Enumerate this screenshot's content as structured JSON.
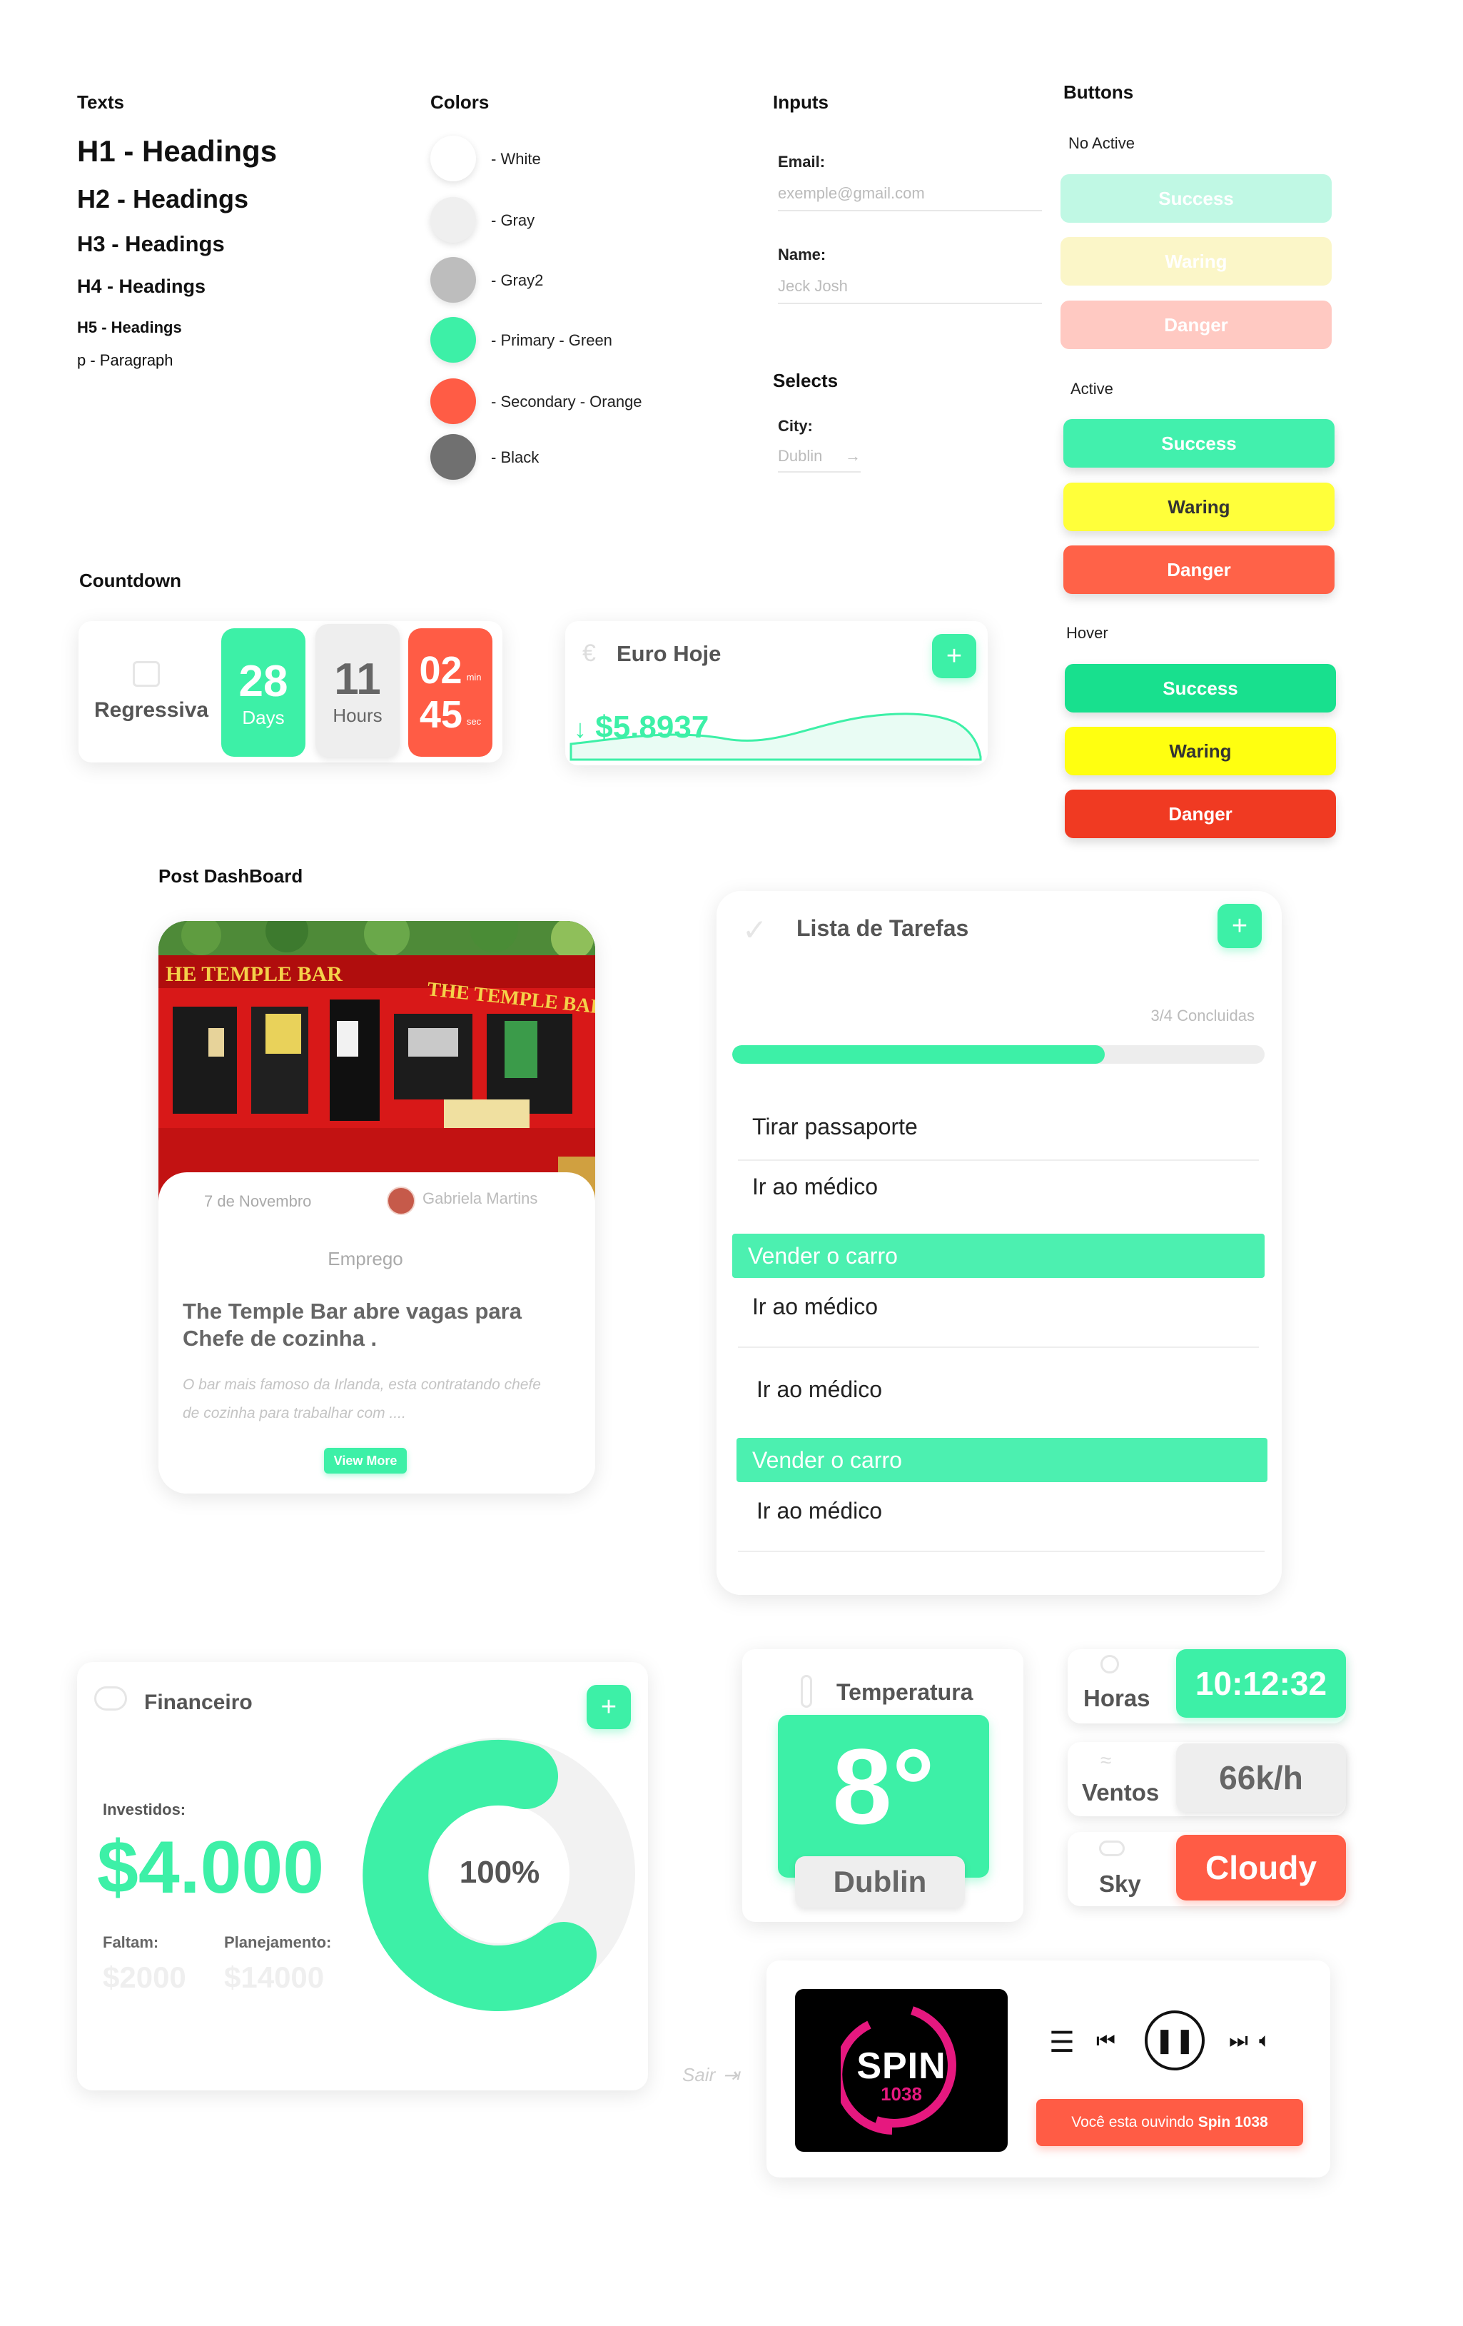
{
  "texts": {
    "title": "Texts",
    "h1": "H1 - Headings",
    "h2": "H2 - Headings",
    "h3": "H3 - Headings",
    "h4": "H4 - Headings",
    "h5": "H5 - Headings",
    "p": "p - Paragraph"
  },
  "colors": {
    "title": "Colors",
    "items": [
      {
        "label": "- White",
        "hex": "#ffffff"
      },
      {
        "label": "- Gray",
        "hex": "#efefef"
      },
      {
        "label": "- Gray2",
        "hex": "#bdbdbd"
      },
      {
        "label": "-  Primary - Green",
        "hex": "#3df0a7"
      },
      {
        "label": "- Secondary - Orange",
        "hex": "#ff5c45"
      },
      {
        "label": "- Black",
        "hex": "#707070"
      }
    ]
  },
  "inputs": {
    "title": "Inputs",
    "email_label": "Email:",
    "email_placeholder": "exemple@gmail.com",
    "name_label": "Name:",
    "name_placeholder": "Jeck Josh"
  },
  "selects": {
    "title": "Selects",
    "city_label": "City:",
    "city_value": "Dublin",
    "arrow_icon": "→"
  },
  "buttons": {
    "title": "Buttons",
    "no_active": {
      "label": "No Active",
      "success": "Success",
      "warning": "Waring",
      "danger": "Danger"
    },
    "active": {
      "label": "Active",
      "success": "Success",
      "warning": "Waring",
      "danger": "Danger"
    },
    "hover": {
      "label": "Hover",
      "success": "Success",
      "warning": "Waring",
      "danger": "Danger"
    },
    "colors": {
      "success": "#3df0a7",
      "warning": "#ffff2a",
      "danger": "#ff5c45"
    }
  },
  "countdown": {
    "title": "Countdown",
    "label": "Regressiva",
    "days_value": "28",
    "days_label": "Days",
    "hours_value": "11",
    "hours_label": "Hours",
    "min_value": "02",
    "min_label": "min",
    "sec_value": "45",
    "sec_label": "sec"
  },
  "euro": {
    "title": "Euro Hoje",
    "value": "$5.8937",
    "plus": "+"
  },
  "post": {
    "section_title": "Post DashBoard",
    "date": "7 de Novembro",
    "author": "Gabriela Martins",
    "category": "Emprego",
    "headline": "The Temple Bar abre vagas para Chefe de cozinha .",
    "excerpt": "O bar mais famoso da Irlanda, esta contratando chefe de cozinha para trabalhar com ....",
    "button": "View More",
    "sign_left": "HE TEMPLE BAR",
    "sign_right": "THE TEMPLE BAR"
  },
  "tasks": {
    "title": "Lista de Tarefas",
    "plus": "+",
    "progress_text": "3/4 Concluidas",
    "progress_fraction": 0.7,
    "items": [
      "Tirar passaporte",
      "Ir ao médico",
      "Vender o carro",
      "Ir ao médico",
      "Ir ao médico",
      "Vender o carro",
      "Ir ao médico"
    ]
  },
  "finance": {
    "title": "Financeiro",
    "plus": "+",
    "invested_label": "Investidos:",
    "invested_value": "$4.000",
    "remaining_label": "Faltam:",
    "remaining_value": "$2000",
    "planned_label": "Planejamento:",
    "planned_value": "$14000",
    "donut_percent": "100%"
  },
  "weather": {
    "temp_title": "Temperatura",
    "temp_value": "8°",
    "city": "Dublin",
    "hours_label": "Horas",
    "hours_value": "10:12:32",
    "wind_label": "Ventos",
    "wind_value": "66k/h",
    "sky_label": "Sky",
    "sky_value": "Cloudy"
  },
  "player": {
    "logo_top": "SPIN",
    "logo_bottom": "1038",
    "now_playing_prefix": "Você esta ouvindo ",
    "now_playing_station": "Spin 1038"
  },
  "misc": {
    "logout": "Sair"
  }
}
